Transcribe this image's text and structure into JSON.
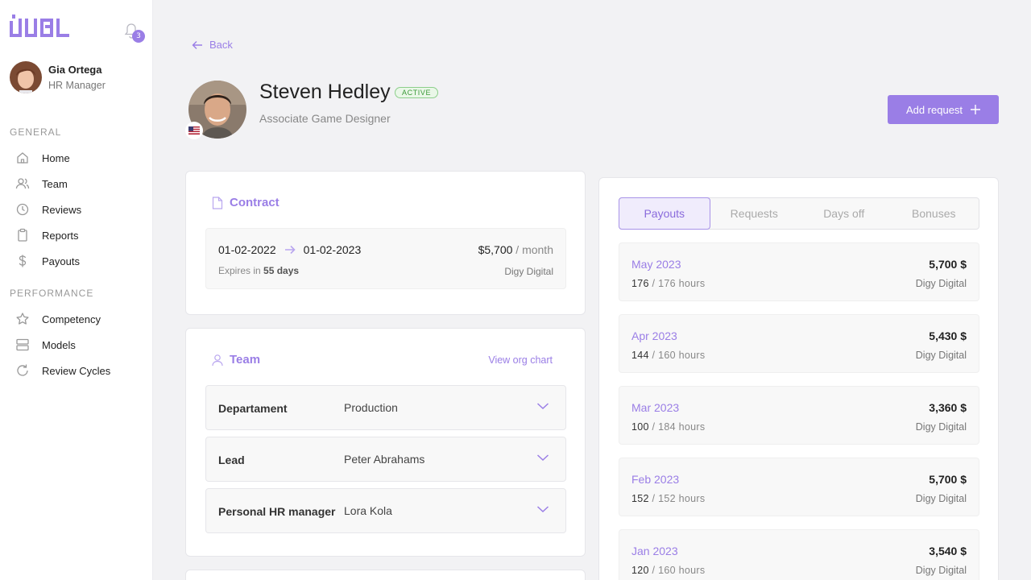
{
  "sidebar": {
    "notification_count": "3",
    "user": {
      "name": "Gia Ortega",
      "role": "HR Manager"
    },
    "sections": [
      {
        "title": "GENERAL",
        "items": [
          {
            "label": "Home",
            "icon": "home-icon"
          },
          {
            "label": "Team",
            "icon": "users-icon"
          },
          {
            "label": "Reviews",
            "icon": "clock-icon"
          },
          {
            "label": "Reports",
            "icon": "clipboard-icon"
          },
          {
            "label": "Payouts",
            "icon": "dollar-icon"
          }
        ]
      },
      {
        "title": "PERFORMANCE",
        "items": [
          {
            "label": "Competency",
            "icon": "star-icon"
          },
          {
            "label": "Models",
            "icon": "layers-icon"
          },
          {
            "label": "Review Cycles",
            "icon": "refresh-icon"
          }
        ]
      }
    ]
  },
  "header": {
    "back_label": "Back",
    "name": "Steven Hedley",
    "status": "ACTIVE",
    "job_title": "Associate Game Designer",
    "add_request_label": "Add request"
  },
  "contract": {
    "title": "Contract",
    "start_date": "01-02-2022",
    "end_date": "01-02-2023",
    "salary": "$5,700",
    "salary_period": "/ month",
    "expires_prefix": "Expires in",
    "expires_value": "55 days",
    "company": "Digy Digital"
  },
  "team": {
    "title": "Team",
    "view_org_label": "View org chart",
    "rows": [
      {
        "key": "Departament",
        "value": "Production"
      },
      {
        "key": "Lead",
        "value": "Peter Abrahams"
      },
      {
        "key": "Personal HR manager",
        "value": "Lora Kola"
      }
    ]
  },
  "payouts": {
    "tabs": [
      "Payouts",
      "Requests",
      "Days off",
      "Bonuses"
    ],
    "active_tab": "Payouts",
    "items": [
      {
        "month": "May 2023",
        "hours_done": "176",
        "hours_total": "/ 176 hours",
        "amount": "5,700 $",
        "company": "Digy Digital"
      },
      {
        "month": "Apr 2023",
        "hours_done": "144",
        "hours_total": "/ 160 hours",
        "amount": "5,430 $",
        "company": "Digy Digital"
      },
      {
        "month": "Mar 2023",
        "hours_done": "100",
        "hours_total": "/ 184 hours",
        "amount": "3,360 $",
        "company": "Digy Digital"
      },
      {
        "month": "Feb 2023",
        "hours_done": "152",
        "hours_total": "/ 152 hours",
        "amount": "5,700 $",
        "company": "Digy Digital"
      },
      {
        "month": "Jan 2023",
        "hours_done": "120",
        "hours_total": "/ 160 hours",
        "amount": "3,540 $",
        "company": "Digy Digital"
      }
    ]
  },
  "colors": {
    "accent": "#9a7ee6",
    "active_badge": "#3d9a3a",
    "background": "#f2f2f4"
  }
}
